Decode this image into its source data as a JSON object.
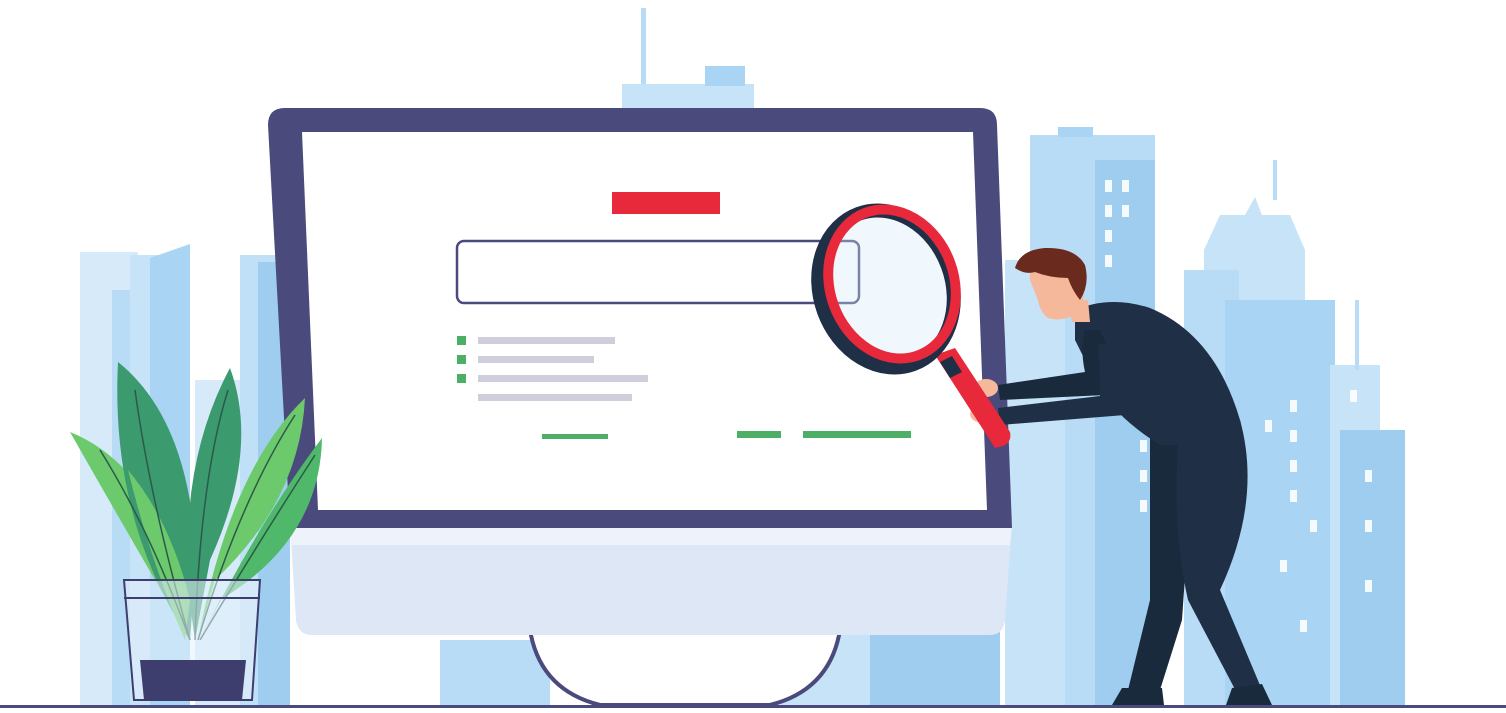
{
  "illustration": {
    "icons": [
      "city-skyline-icon",
      "desktop-monitor-icon",
      "magnifying-glass-icon",
      "person-icon",
      "potted-plant-icon"
    ],
    "colors": {
      "background": "#ffffff",
      "skyline_light": "#d6eaf9",
      "skyline_mid": "#b8dcf5",
      "skyline_dark": "#9fcdf0",
      "monitor_frame": "#4a4a7c",
      "screen": "#ffffff",
      "monitor_stand_top": "#ffffff",
      "monitor_stand_bottom": "#dde7f5",
      "title_bar": "#e8283b",
      "search_box_border": "#4a4a7c",
      "list_bullet": "#4caf65",
      "list_line": "#cfcfdc",
      "action_line": "#4caf65",
      "magnifier_ring": "#e8283b",
      "magnifier_rim": "#1f2f46",
      "person_suit": "#1f2f46",
      "person_skin": "#f5b89a",
      "person_hair": "#6a2a1e",
      "leaf_light": "#6cc96c",
      "leaf_dark": "#3b9a6e",
      "pot": "#3d3e6e",
      "ground_line": "#4a4a7c"
    }
  }
}
